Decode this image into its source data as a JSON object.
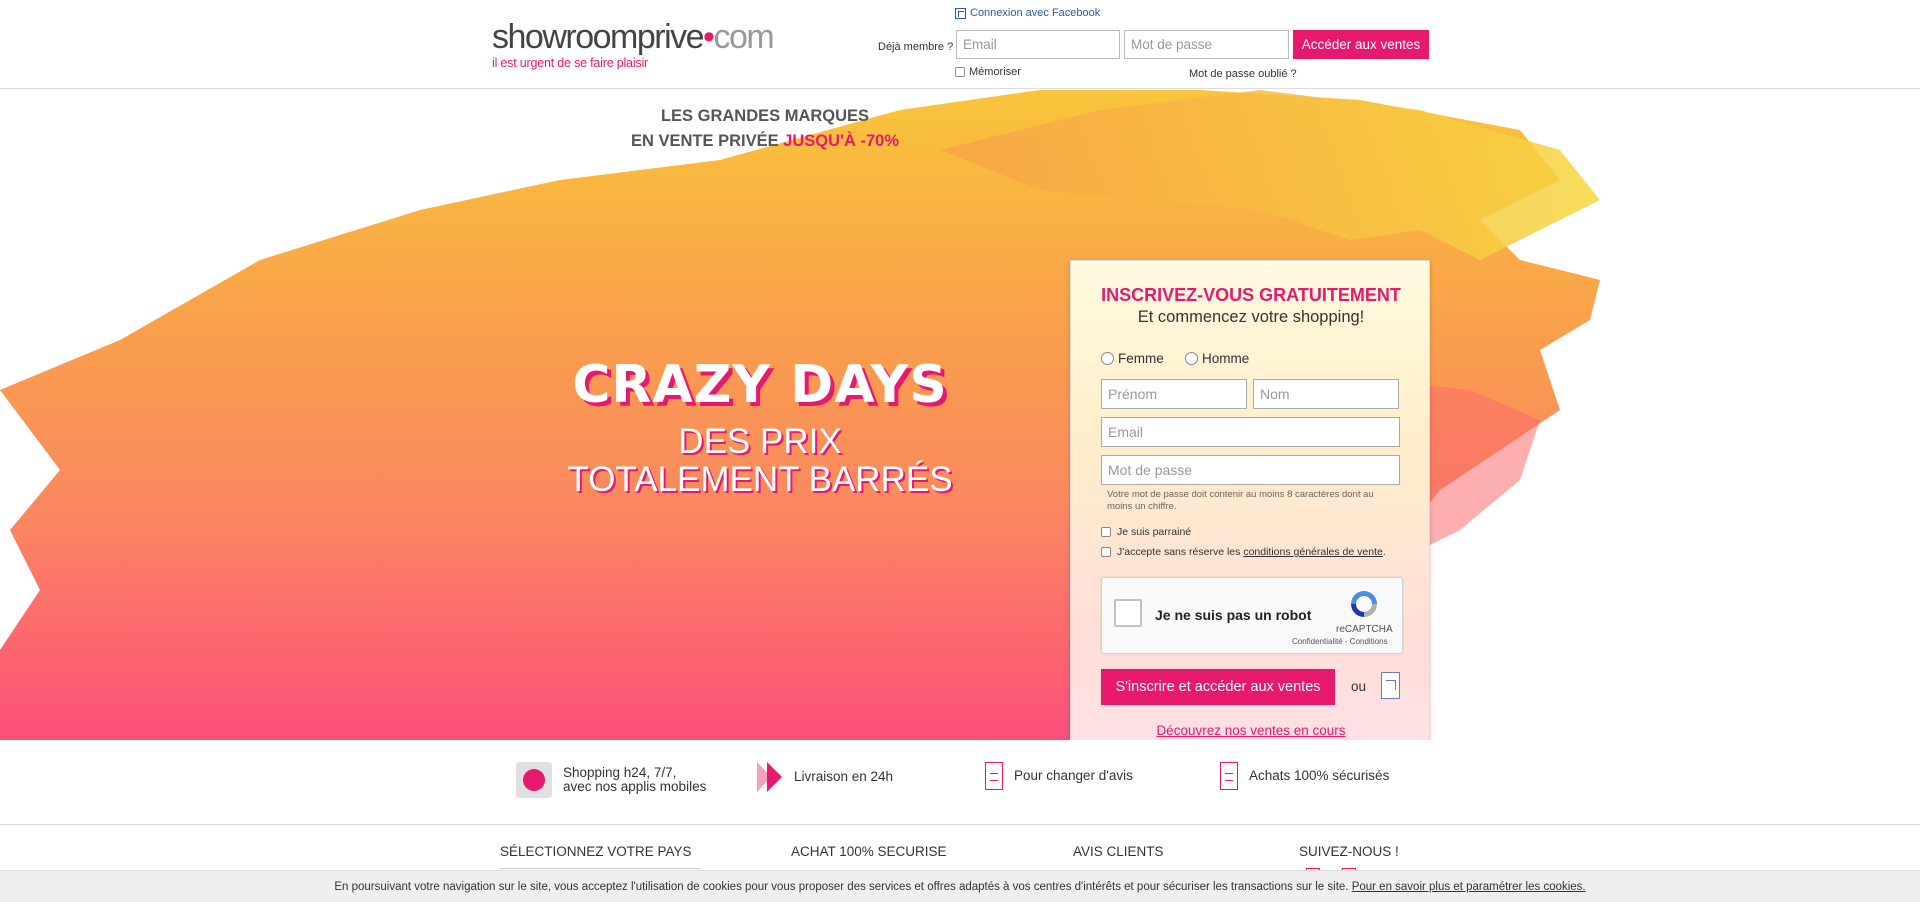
{
  "header": {
    "logo_text": "showroomprive",
    "logo_dot": "•",
    "logo_com": "com",
    "tagline": "il est urgent de se faire plaisir",
    "facebook_connect": "Connexion avec Facebook",
    "member_label": "Déjà membre ?",
    "email_placeholder": "Email",
    "password_placeholder": "Mot de passe",
    "login_button": "Accéder aux ventes",
    "remember_label": "Mémoriser",
    "forgot_password": "Mot de passe oublié ?"
  },
  "hero": {
    "headline_line1": "LES GRANDES MARQUES",
    "headline_line2_prefix": "EN VENTE PRIVÉE ",
    "headline_line2_highlight": "JUSQU'À -70%",
    "campaign_title": "CRAZY DAYS",
    "campaign_sub1": "DES PRIX",
    "campaign_sub2": "TOTALEMENT BARRÉS"
  },
  "signup": {
    "title": "INSCRIVEZ-VOUS GRATUITEMENT",
    "subtitle": "Et commencez votre shopping!",
    "gender_female": "Femme",
    "gender_male": "Homme",
    "firstname_placeholder": "Prénom",
    "lastname_placeholder": "Nom",
    "email_placeholder": "Email",
    "password_placeholder": "Mot de passe",
    "password_hint": "Votre mot de passe doit contenir au moins 8 caractères dont au moins un chiffre.",
    "referral_label": "Je suis parrainé",
    "cgv_prefix": "J'accepte sans réserve les ",
    "cgv_link": "conditions générales de vente",
    "cgv_suffix": ".",
    "captcha_label": "Je ne suis pas un robot",
    "captcha_brand": "reCAPTCHA",
    "captcha_terms": "Confidentialité - Conditions",
    "submit_button": "S'inscrire et accéder aux ventes",
    "or_label": "ou",
    "discover_link": "Découvrez nos ventes en cours"
  },
  "features": [
    {
      "line1": "Shopping h24, 7/7,",
      "line2": "avec nos applis mobiles",
      "icon": "mobile-icon"
    },
    {
      "line1": "Livraison en 24h",
      "line2": "",
      "icon": "fast-delivery-icon"
    },
    {
      "line1": "Pour changer d'avis",
      "line2": "",
      "icon": "return-icon"
    },
    {
      "line1": "Achats 100% sécurisés",
      "line2": "",
      "icon": "secure-payment-icon"
    }
  ],
  "footer": {
    "country": "SÉLECTIONNEZ VOTRE PAYS",
    "secure": "ACHAT 100% SECURISE",
    "reviews": "AVIS CLIENTS",
    "follow": "SUIVEZ-NOUS !"
  },
  "cookie": {
    "text": "En poursuivant votre navigation sur le site, vous acceptez l'utilisation de cookies pour vous proposer des services et offres adaptés à vos centres d'intérêts et pour sécuriser les transactions sur le site. ",
    "link": "Pour en savoir plus et paramétrer les cookies."
  },
  "colors": {
    "brand_pink": "#e6196f",
    "splash_yellow": "#f9c93a",
    "splash_orange": "#f9a04a"
  }
}
